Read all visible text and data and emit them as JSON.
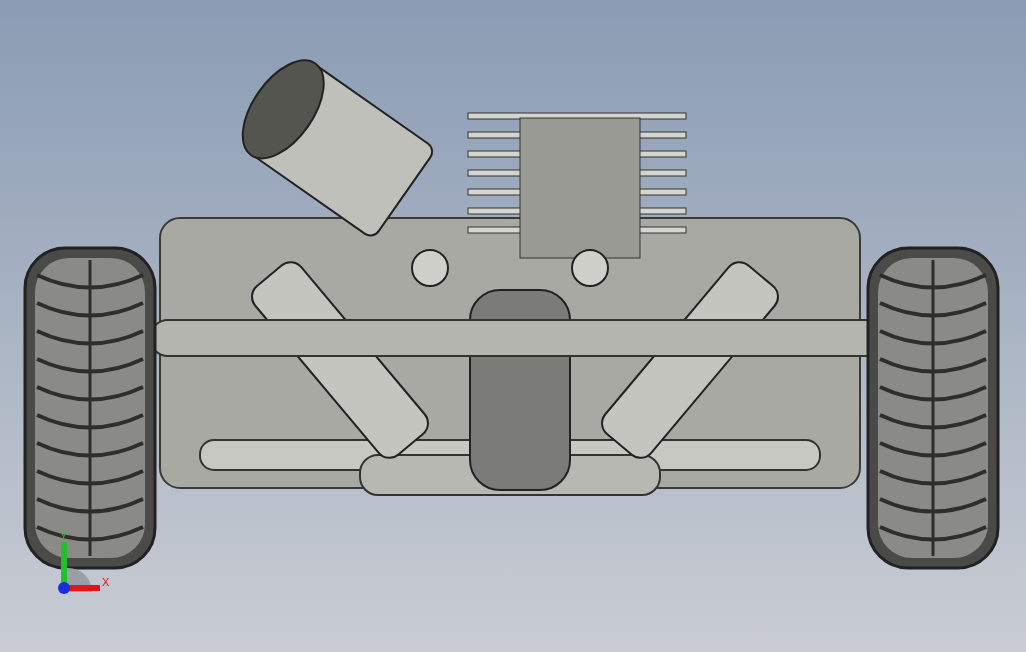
{
  "viewport": {
    "triad": {
      "axes": [
        {
          "label": "Y",
          "kind": "vertical",
          "color": "#22c02a"
        },
        {
          "label": "X",
          "kind": "horizontal",
          "color": "#e0161b"
        }
      ]
    }
  }
}
